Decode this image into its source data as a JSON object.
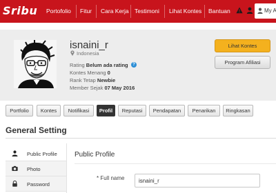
{
  "brand": {
    "logo": "Sribu",
    "color": "#c8141c"
  },
  "nav": {
    "items": [
      {
        "label": "Portofolio"
      },
      {
        "label": "Fitur"
      },
      {
        "label": "Cara Kerja"
      },
      {
        "label": "Testimoni"
      },
      {
        "label": "Lihat Kontes"
      },
      {
        "label": "Bantuan"
      }
    ],
    "alert_icon": "warning-icon",
    "user_icon": "user-icon",
    "user_menu_label": "My A"
  },
  "profile": {
    "username": "isnaini_r",
    "location": "Indonesia",
    "rating_label": "Rating",
    "rating_value": "Belum ada rating",
    "wins_label": "Kontes Menang",
    "wins_value": "0",
    "rank_label": "Rank Tetap",
    "rank_value": "Newbie",
    "member_label": "Member Sejak",
    "member_value": "07 May 2016",
    "btn_contests": "Lihat Kontes",
    "btn_affiliate": "Program Afiliasi"
  },
  "tabs": [
    {
      "label": "Portfolio"
    },
    {
      "label": "Kontes"
    },
    {
      "label": "Notifikasi"
    },
    {
      "label": "Profil",
      "active": true
    },
    {
      "label": "Reputasi"
    },
    {
      "label": "Pendapatan"
    },
    {
      "label": "Penarikan"
    },
    {
      "label": "Ringkasan"
    }
  ],
  "settings": {
    "title": "General Setting",
    "menu": [
      {
        "label": "Public Profile",
        "icon": "user-icon"
      },
      {
        "label": "Photo",
        "icon": "camera-icon"
      },
      {
        "label": "Password",
        "icon": "lock-icon"
      }
    ],
    "panel_title": "Public Profile",
    "full_name_label": "* Full name",
    "full_name_value": "isnaini_r"
  }
}
